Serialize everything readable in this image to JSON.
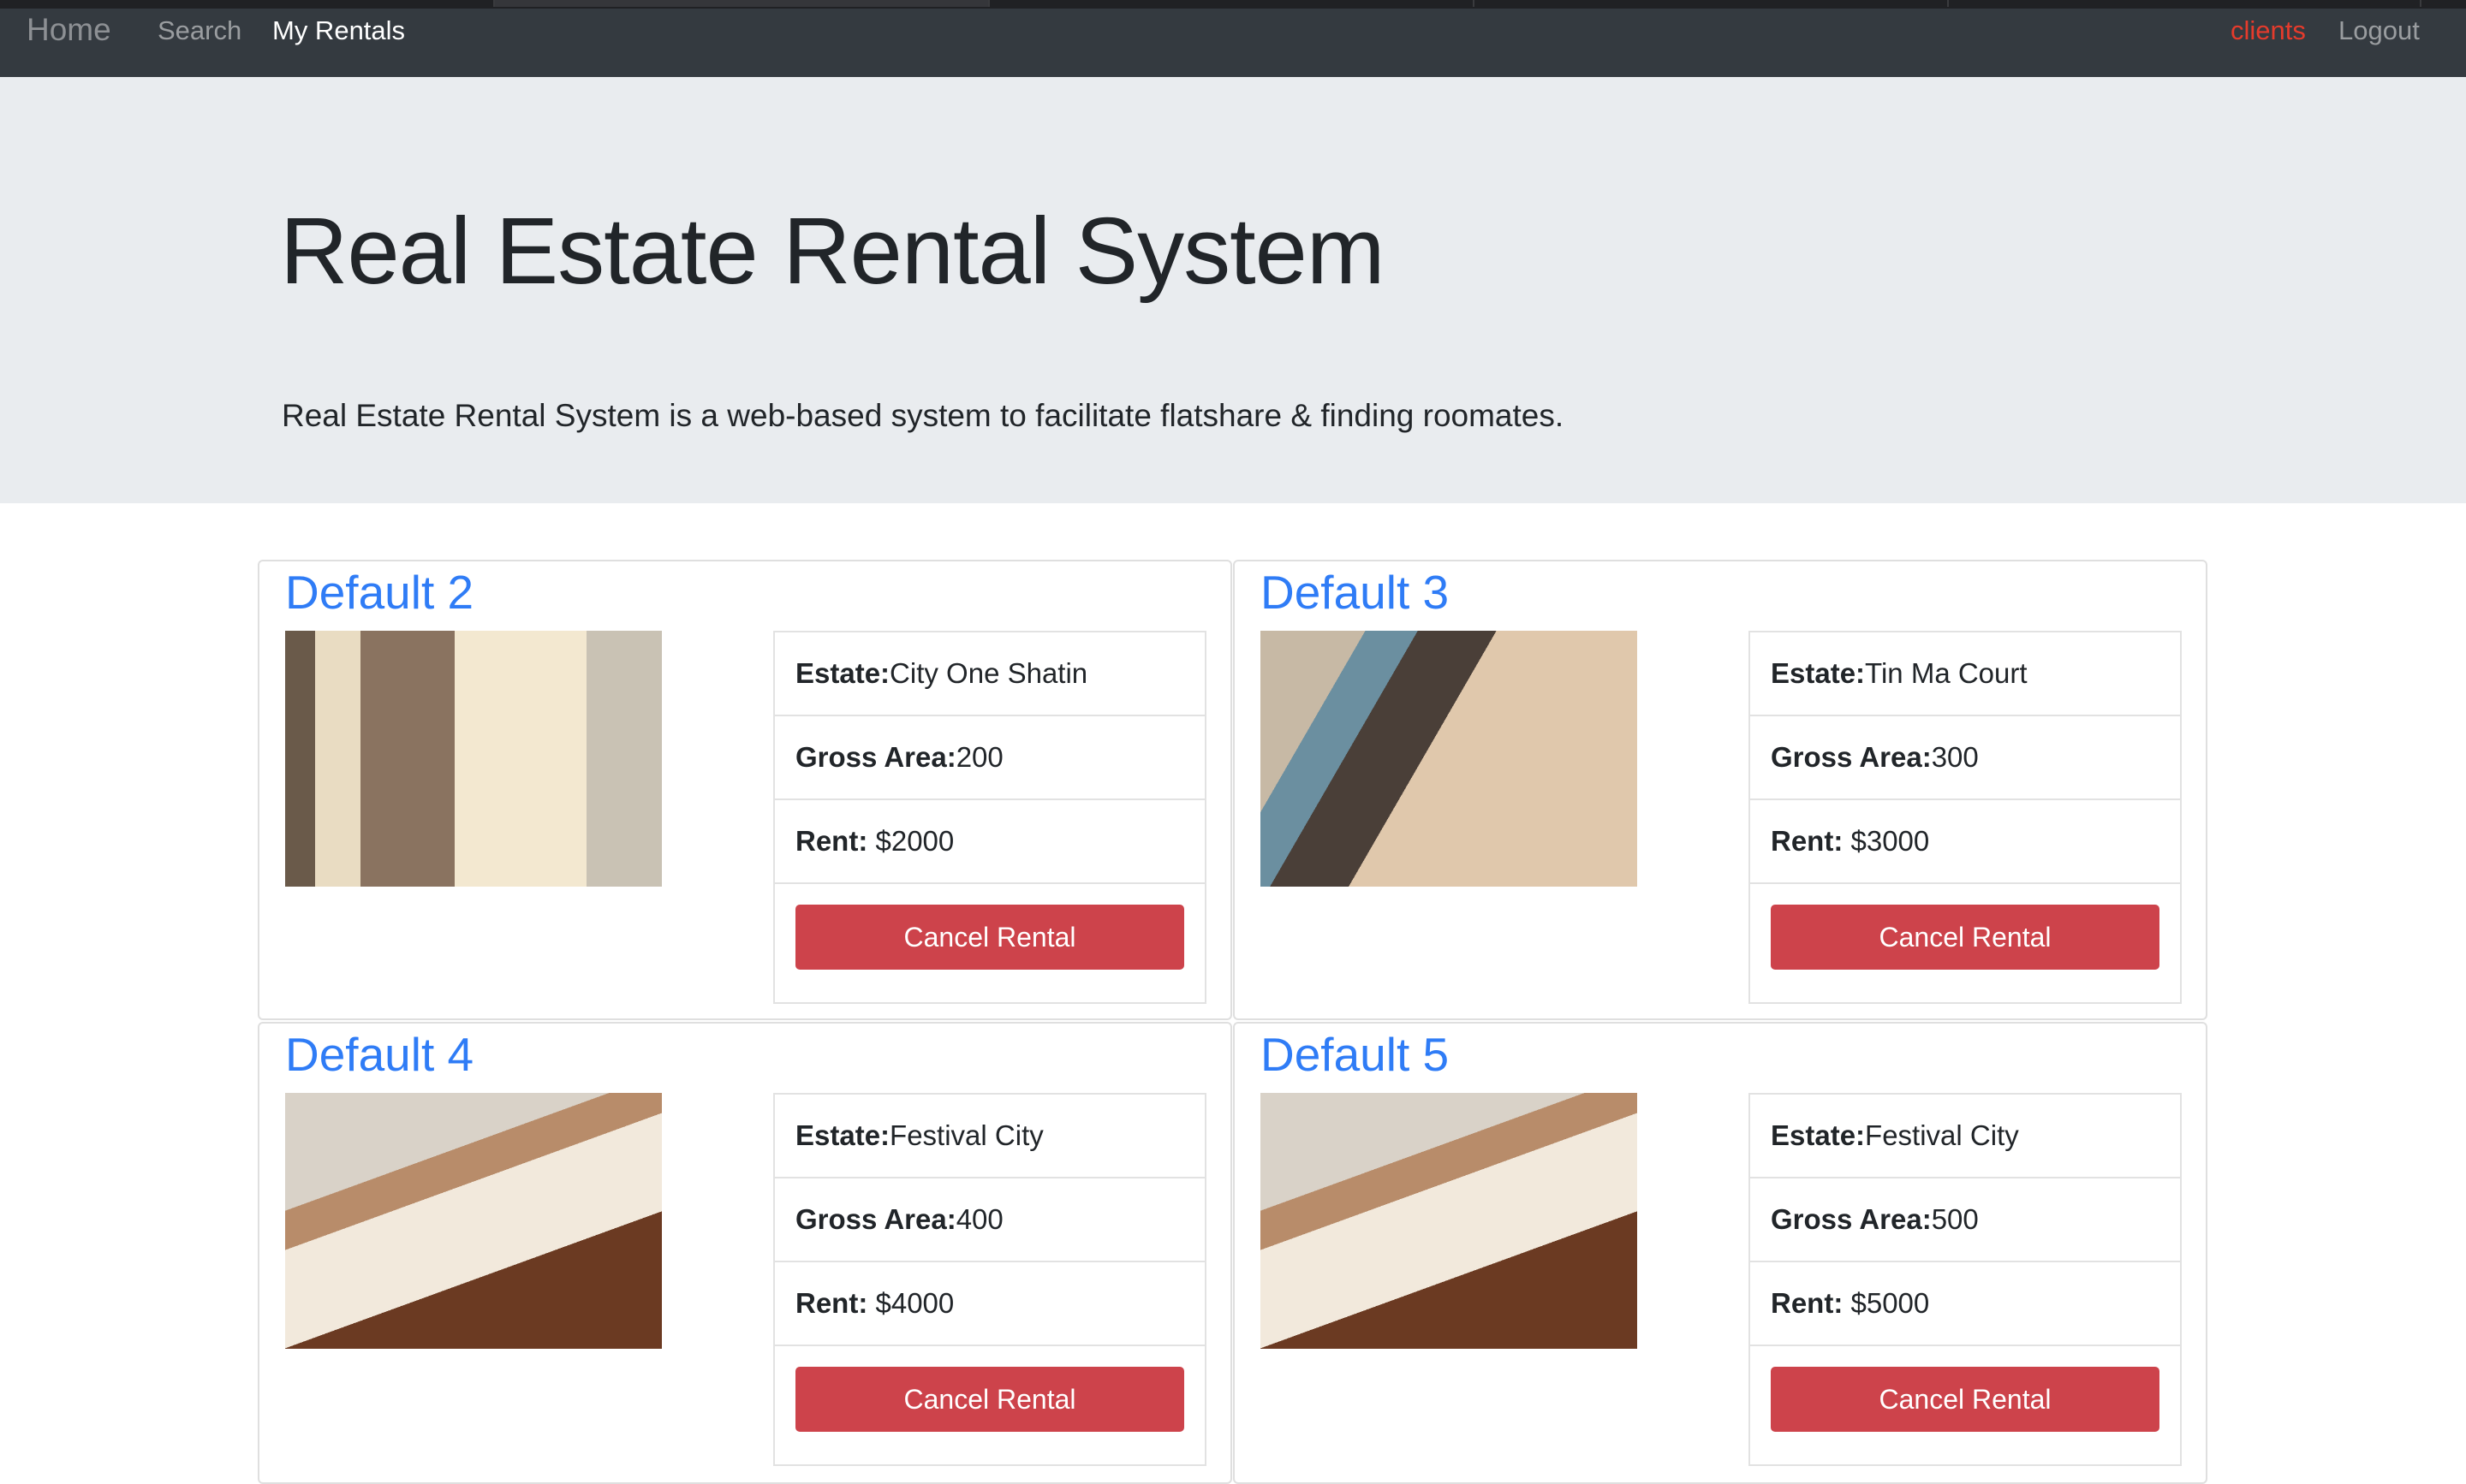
{
  "nav": {
    "home": "Home",
    "search": "Search",
    "my_rentals": "My Rentals",
    "user": "clients",
    "logout": "Logout"
  },
  "jumbotron": {
    "title": "Real Estate Rental System",
    "subtitle": "Real Estate Rental System is a web-based system to facilitate flatshare & finding roomates."
  },
  "labels": {
    "estate": "Estate:",
    "gross_area": "Gross Area:",
    "rent": "Rent:",
    "cancel": "Cancel Rental"
  },
  "rentals": [
    {
      "title": "Default 2",
      "estate": "City One Shatin",
      "gross_area": "200",
      "rent": " $2000"
    },
    {
      "title": "Default 3",
      "estate": "Tin Ma Court",
      "gross_area": "300",
      "rent": " $3000"
    },
    {
      "title": "Default 4",
      "estate": "Festival City",
      "gross_area": "400",
      "rent": " $4000"
    },
    {
      "title": "Default 5",
      "estate": "Festival City",
      "gross_area": "500",
      "rent": " $5000"
    }
  ]
}
